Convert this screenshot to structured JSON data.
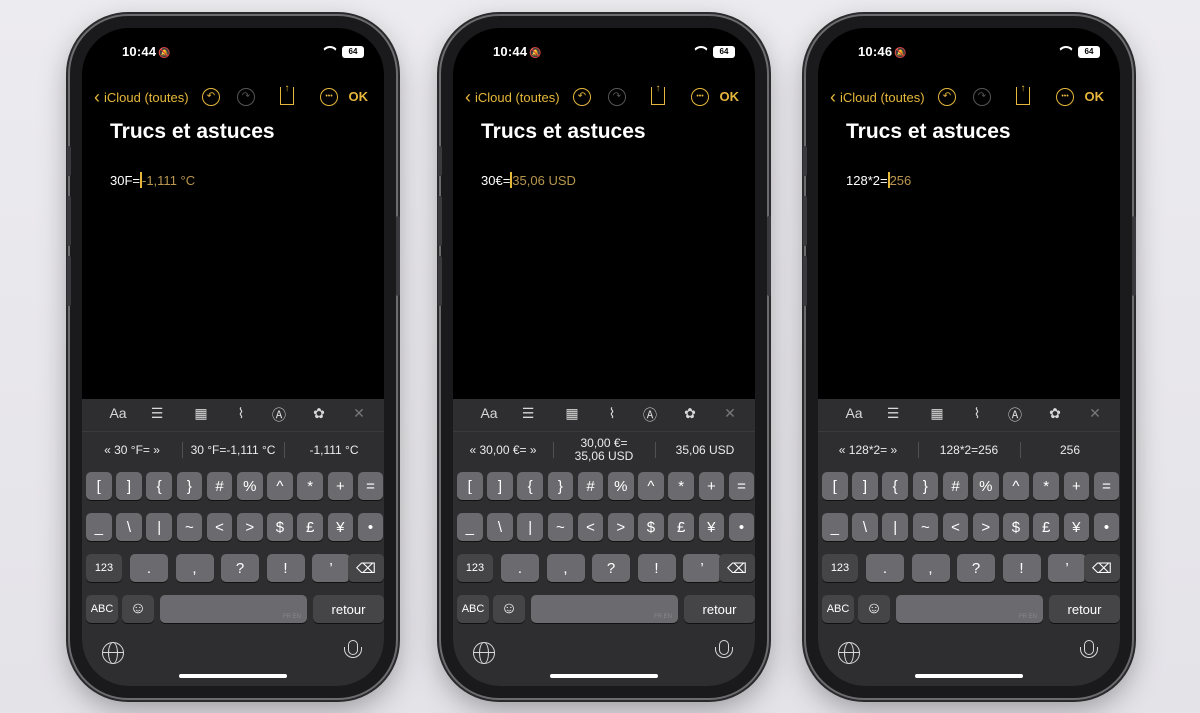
{
  "accent_color": "#e5b73b",
  "phones": [
    {
      "status": {
        "time": "10:44",
        "battery": "64"
      },
      "toolbar": {
        "back": "iCloud (toutes)",
        "done": "OK"
      },
      "note": {
        "title": "Trucs et astuces",
        "input": "30F=",
        "result": "-1,111 °C"
      },
      "suggestions": [
        "« 30 °F= »",
        "30 °F=-1,111 °C",
        "-1,111 °C"
      ]
    },
    {
      "status": {
        "time": "10:44",
        "battery": "64"
      },
      "toolbar": {
        "back": "iCloud (toutes)",
        "done": "OK"
      },
      "note": {
        "title": "Trucs et astuces",
        "input": "30€=",
        "result": "35,06 USD"
      },
      "suggestions": [
        "« 30,00 €= »",
        "30,00 €=\n35,06 USD",
        "35,06 USD"
      ]
    },
    {
      "status": {
        "time": "10:46",
        "battery": "64"
      },
      "toolbar": {
        "back": "iCloud (toutes)",
        "done": "OK"
      },
      "note": {
        "title": "Trucs et astuces",
        "input": "128*2=",
        "result": "256"
      },
      "suggestions": [
        "« 128*2= »",
        "128*2=256",
        "256"
      ]
    }
  ],
  "format_bar": [
    "Aa",
    "checklist-icon",
    "table-icon",
    "paperclip-icon",
    "pen-icon",
    "ai-icon",
    "close-icon"
  ],
  "keyboard": {
    "row1": [
      "[",
      "]",
      "{",
      "}",
      "#",
      "%",
      "^",
      "*",
      "+",
      "="
    ],
    "row2": [
      "_",
      "\\",
      "|",
      "~",
      "<",
      ">",
      "$",
      "£",
      "¥",
      "•"
    ],
    "row3": [
      ".",
      ",",
      "?",
      "!",
      "’"
    ],
    "mode_123": "123",
    "mode_abc": "ABC",
    "return": "retour",
    "space_hint": "FR EN"
  }
}
